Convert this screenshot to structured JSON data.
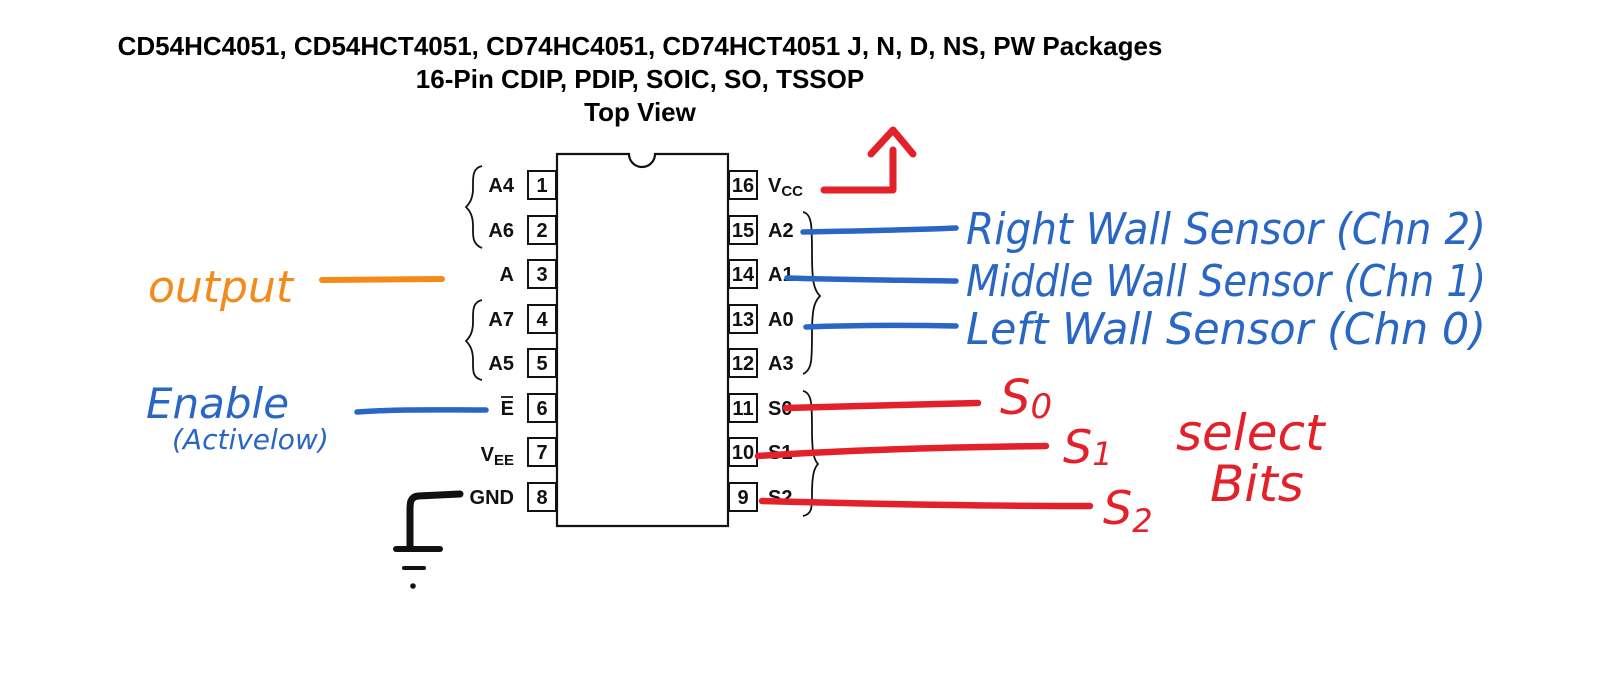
{
  "header": {
    "title_line1": "CD54HC4051, CD54HCT4051, CD74HC4051, CD74HCT4051 J, N, D, NS, PW Packages",
    "title_line2": "16-Pin CDIP, PDIP, SOIC, SO, TSSOP",
    "title_line3": "Top View"
  },
  "pins_left": [
    {
      "num": "1",
      "name": "A4",
      "sub": ""
    },
    {
      "num": "2",
      "name": "A6",
      "sub": ""
    },
    {
      "num": "3",
      "name": "A",
      "sub": ""
    },
    {
      "num": "4",
      "name": "A7",
      "sub": ""
    },
    {
      "num": "5",
      "name": "A5",
      "sub": ""
    },
    {
      "num": "6",
      "name": "E",
      "sub": ""
    },
    {
      "num": "7",
      "name": "V",
      "sub": "EE"
    },
    {
      "num": "8",
      "name": "GND",
      "sub": ""
    }
  ],
  "pins_right": [
    {
      "num": "16",
      "name": "V",
      "sub": "CC"
    },
    {
      "num": "15",
      "name": "A2",
      "sub": ""
    },
    {
      "num": "14",
      "name": "A1",
      "sub": ""
    },
    {
      "num": "13",
      "name": "A0",
      "sub": ""
    },
    {
      "num": "12",
      "name": "A3",
      "sub": ""
    },
    {
      "num": "11",
      "name": "S0",
      "sub": ""
    },
    {
      "num": "10",
      "name": "S1",
      "sub": ""
    },
    {
      "num": "9",
      "name": "S2",
      "sub": ""
    }
  ],
  "annotations": {
    "output": "output",
    "enable": "Enable",
    "enable_note": "(Activelow)",
    "right_sensor": "Right Wall Sensor (Chn 2)",
    "middle_sensor": "Middle  Wall Sensor (Chn 1)",
    "left_sensor": "Left    Wall Sensor (Chn 0)",
    "s0": "S",
    "s0_sub": "0",
    "s1": "S",
    "s1_sub": "1",
    "s2": "S",
    "s2_sub": "2",
    "select": "select",
    "bits": "Bits"
  },
  "colors": {
    "blue": "#2a66c4",
    "orange": "#f38b1c",
    "red": "#e3212a",
    "ink": "#111111"
  }
}
